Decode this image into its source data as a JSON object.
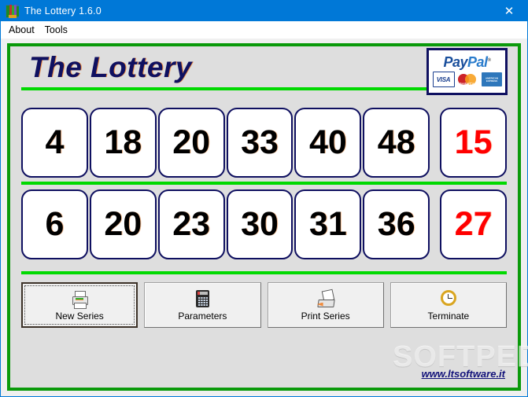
{
  "window": {
    "title": "The Lottery 1.6.0",
    "icon": "app-lottery-icon",
    "close_label": "✕"
  },
  "menubar": {
    "items": [
      {
        "label": "About"
      },
      {
        "label": "Tools"
      }
    ]
  },
  "header": {
    "brand": "The Lottery",
    "paypal": {
      "word_pay": "Pay",
      "word_pal": "Pal",
      "registered": "®",
      "cards": [
        {
          "name": "visa-card",
          "label": "VISA"
        },
        {
          "name": "mastercard-card",
          "label": "MasterCard"
        },
        {
          "name": "amex-card",
          "label": "AMERICAN EXPRESS"
        }
      ]
    }
  },
  "series": [
    {
      "name": "series-row-1",
      "numbers": [
        "4",
        "18",
        "20",
        "33",
        "40",
        "48"
      ],
      "special": "15"
    },
    {
      "name": "series-row-2",
      "numbers": [
        "6",
        "20",
        "23",
        "30",
        "31",
        "36"
      ],
      "special": "27"
    }
  ],
  "buttons": [
    {
      "name": "new-series-button",
      "label": "New Series",
      "icon": "printer-icon",
      "focused": true
    },
    {
      "name": "parameters-button",
      "label": "Parameters",
      "icon": "calculator-icon",
      "focused": false
    },
    {
      "name": "print-series-button",
      "label": "Print Series",
      "icon": "print-out-icon",
      "focused": false
    },
    {
      "name": "terminate-button",
      "label": "Terminate",
      "icon": "clock-icon",
      "focused": false
    }
  ],
  "footer": {
    "link": "www.ltsoftware.it"
  },
  "watermark": {
    "text": "SOFTPEDIA",
    "registered": "®"
  },
  "colors": {
    "titlebar": "#0078d7",
    "panel_bg": "#dedede",
    "frame_green": "#0a9a0a",
    "rule_green": "#00d900",
    "navy": "#0f1060",
    "special_red": "#ff0000"
  }
}
